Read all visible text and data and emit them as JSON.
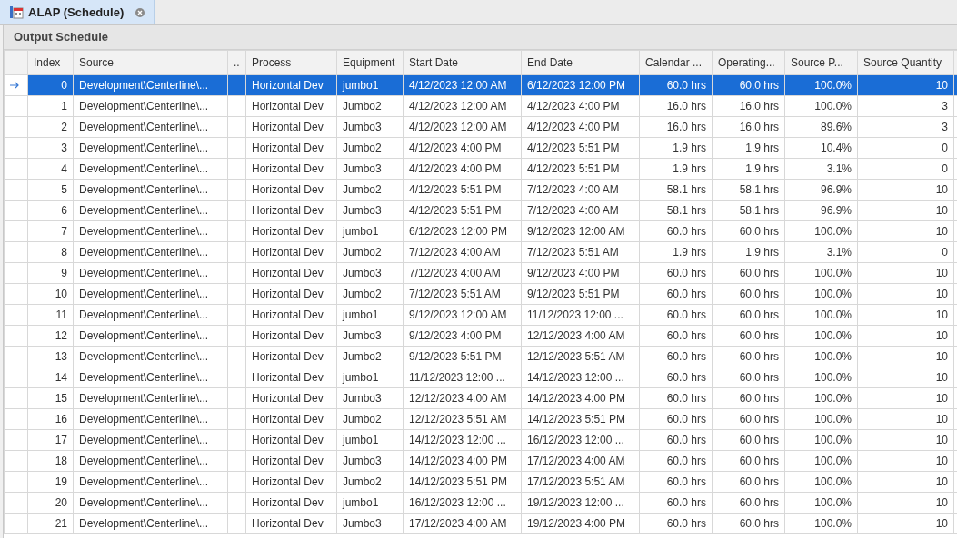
{
  "tab": {
    "title": "ALAP (Schedule)",
    "selected": true
  },
  "panel": {
    "title": "Output Schedule"
  },
  "table": {
    "columns": [
      "Index",
      "Source",
      "..",
      "Process",
      "Equipment",
      "Start Date",
      "End Date",
      "Calendar ...",
      "Operating...",
      "Source P...",
      "Source Quantity"
    ],
    "rows": [
      {
        "selected": true,
        "cells": [
          "0",
          "Development\\Centerline\\...",
          "",
          "Horizontal Dev",
          "jumbo1",
          "4/12/2023 12:00 AM",
          "6/12/2023 12:00 PM",
          "60.0 hrs",
          "60.0 hrs",
          "100.0%",
          "10"
        ]
      },
      {
        "selected": false,
        "cells": [
          "1",
          "Development\\Centerline\\...",
          "",
          "Horizontal Dev",
          "Jumbo2",
          "4/12/2023 12:00 AM",
          "4/12/2023 4:00 PM",
          "16.0 hrs",
          "16.0 hrs",
          "100.0%",
          "3"
        ]
      },
      {
        "selected": false,
        "cells": [
          "2",
          "Development\\Centerline\\...",
          "",
          "Horizontal Dev",
          "Jumbo3",
          "4/12/2023 12:00 AM",
          "4/12/2023 4:00 PM",
          "16.0 hrs",
          "16.0 hrs",
          "89.6%",
          "3"
        ]
      },
      {
        "selected": false,
        "cells": [
          "3",
          "Development\\Centerline\\...",
          "",
          "Horizontal Dev",
          "Jumbo2",
          "4/12/2023 4:00 PM",
          "4/12/2023 5:51 PM",
          "1.9 hrs",
          "1.9 hrs",
          "10.4%",
          "0"
        ]
      },
      {
        "selected": false,
        "cells": [
          "4",
          "Development\\Centerline\\...",
          "",
          "Horizontal Dev",
          "Jumbo3",
          "4/12/2023 4:00 PM",
          "4/12/2023 5:51 PM",
          "1.9 hrs",
          "1.9 hrs",
          "3.1%",
          "0"
        ]
      },
      {
        "selected": false,
        "cells": [
          "5",
          "Development\\Centerline\\...",
          "",
          "Horizontal Dev",
          "Jumbo2",
          "4/12/2023 5:51 PM",
          "7/12/2023 4:00 AM",
          "58.1 hrs",
          "58.1 hrs",
          "96.9%",
          "10"
        ]
      },
      {
        "selected": false,
        "cells": [
          "6",
          "Development\\Centerline\\...",
          "",
          "Horizontal Dev",
          "Jumbo3",
          "4/12/2023 5:51 PM",
          "7/12/2023 4:00 AM",
          "58.1 hrs",
          "58.1 hrs",
          "96.9%",
          "10"
        ]
      },
      {
        "selected": false,
        "cells": [
          "7",
          "Development\\Centerline\\...",
          "",
          "Horizontal Dev",
          "jumbo1",
          "6/12/2023 12:00 PM",
          "9/12/2023 12:00 AM",
          "60.0 hrs",
          "60.0 hrs",
          "100.0%",
          "10"
        ]
      },
      {
        "selected": false,
        "cells": [
          "8",
          "Development\\Centerline\\...",
          "",
          "Horizontal Dev",
          "Jumbo2",
          "7/12/2023 4:00 AM",
          "7/12/2023 5:51 AM",
          "1.9 hrs",
          "1.9 hrs",
          "3.1%",
          "0"
        ]
      },
      {
        "selected": false,
        "cells": [
          "9",
          "Development\\Centerline\\...",
          "",
          "Horizontal Dev",
          "Jumbo3",
          "7/12/2023 4:00 AM",
          "9/12/2023 4:00 PM",
          "60.0 hrs",
          "60.0 hrs",
          "100.0%",
          "10"
        ]
      },
      {
        "selected": false,
        "cells": [
          "10",
          "Development\\Centerline\\...",
          "",
          "Horizontal Dev",
          "Jumbo2",
          "7/12/2023 5:51 AM",
          "9/12/2023 5:51 PM",
          "60.0 hrs",
          "60.0 hrs",
          "100.0%",
          "10"
        ]
      },
      {
        "selected": false,
        "cells": [
          "11",
          "Development\\Centerline\\...",
          "",
          "Horizontal Dev",
          "jumbo1",
          "9/12/2023 12:00 AM",
          "11/12/2023 12:00 ...",
          "60.0 hrs",
          "60.0 hrs",
          "100.0%",
          "10"
        ]
      },
      {
        "selected": false,
        "cells": [
          "12",
          "Development\\Centerline\\...",
          "",
          "Horizontal Dev",
          "Jumbo3",
          "9/12/2023 4:00 PM",
          "12/12/2023 4:00 AM",
          "60.0 hrs",
          "60.0 hrs",
          "100.0%",
          "10"
        ]
      },
      {
        "selected": false,
        "cells": [
          "13",
          "Development\\Centerline\\...",
          "",
          "Horizontal Dev",
          "Jumbo2",
          "9/12/2023 5:51 PM",
          "12/12/2023 5:51 AM",
          "60.0 hrs",
          "60.0 hrs",
          "100.0%",
          "10"
        ]
      },
      {
        "selected": false,
        "cells": [
          "14",
          "Development\\Centerline\\...",
          "",
          "Horizontal Dev",
          "jumbo1",
          "11/12/2023 12:00 ...",
          "14/12/2023 12:00 ...",
          "60.0 hrs",
          "60.0 hrs",
          "100.0%",
          "10"
        ]
      },
      {
        "selected": false,
        "cells": [
          "15",
          "Development\\Centerline\\...",
          "",
          "Horizontal Dev",
          "Jumbo3",
          "12/12/2023 4:00 AM",
          "14/12/2023 4:00 PM",
          "60.0 hrs",
          "60.0 hrs",
          "100.0%",
          "10"
        ]
      },
      {
        "selected": false,
        "cells": [
          "16",
          "Development\\Centerline\\...",
          "",
          "Horizontal Dev",
          "Jumbo2",
          "12/12/2023 5:51 AM",
          "14/12/2023 5:51 PM",
          "60.0 hrs",
          "60.0 hrs",
          "100.0%",
          "10"
        ]
      },
      {
        "selected": false,
        "cells": [
          "17",
          "Development\\Centerline\\...",
          "",
          "Horizontal Dev",
          "jumbo1",
          "14/12/2023 12:00 ...",
          "16/12/2023 12:00 ...",
          "60.0 hrs",
          "60.0 hrs",
          "100.0%",
          "10"
        ]
      },
      {
        "selected": false,
        "cells": [
          "18",
          "Development\\Centerline\\...",
          "",
          "Horizontal Dev",
          "Jumbo3",
          "14/12/2023 4:00 PM",
          "17/12/2023 4:00 AM",
          "60.0 hrs",
          "60.0 hrs",
          "100.0%",
          "10"
        ]
      },
      {
        "selected": false,
        "cells": [
          "19",
          "Development\\Centerline\\...",
          "",
          "Horizontal Dev",
          "Jumbo2",
          "14/12/2023 5:51 PM",
          "17/12/2023 5:51 AM",
          "60.0 hrs",
          "60.0 hrs",
          "100.0%",
          "10"
        ]
      },
      {
        "selected": false,
        "cells": [
          "20",
          "Development\\Centerline\\...",
          "",
          "Horizontal Dev",
          "jumbo1",
          "16/12/2023 12:00 ...",
          "19/12/2023 12:00 ...",
          "60.0 hrs",
          "60.0 hrs",
          "100.0%",
          "10"
        ]
      },
      {
        "selected": false,
        "cells": [
          "21",
          "Development\\Centerline\\...",
          "",
          "Horizontal Dev",
          "Jumbo3",
          "17/12/2023 4:00 AM",
          "19/12/2023 4:00 PM",
          "60.0 hrs",
          "60.0 hrs",
          "100.0%",
          "10"
        ]
      }
    ]
  }
}
